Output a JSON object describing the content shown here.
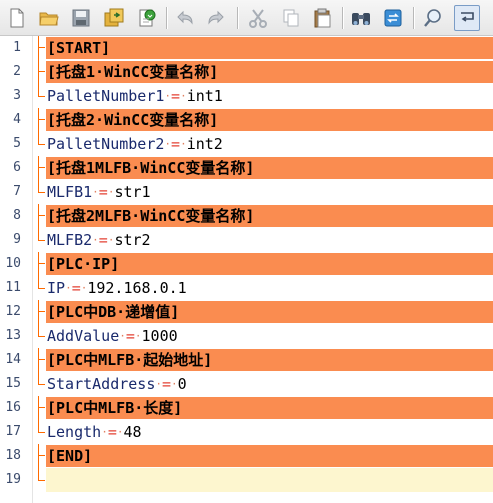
{
  "toolbar": {
    "buttons": [
      {
        "icon": "new-file-icon"
      },
      {
        "icon": "open-folder-icon"
      },
      {
        "icon": "save-icon"
      },
      {
        "icon": "save-all-icon"
      },
      {
        "icon": "reload-icon"
      },
      {
        "icon": "undo-icon"
      },
      {
        "icon": "redo-icon"
      },
      {
        "icon": "cut-icon"
      },
      {
        "icon": "copy-icon"
      },
      {
        "icon": "paste-icon"
      },
      {
        "icon": "find-icon"
      },
      {
        "icon": "replace-icon"
      },
      {
        "icon": "zoom-icon"
      },
      {
        "icon": "wrap-icon"
      }
    ]
  },
  "colors": {
    "section_highlight": "#fa8c50",
    "fold_line": "#ff6a00",
    "current_line": "#fdf6cf",
    "key_text": "#1a2a6c",
    "operator": "#e34234"
  },
  "lines": [
    {
      "n": "1",
      "type": "section",
      "text": "[START]"
    },
    {
      "n": "2",
      "type": "section",
      "text": "[托盘1·WinCC变量名称]"
    },
    {
      "n": "3",
      "type": "kv",
      "key": "PalletNumber1",
      "op": "=",
      "value": "int1"
    },
    {
      "n": "4",
      "type": "section",
      "text": "[托盘2·WinCC变量名称]"
    },
    {
      "n": "5",
      "type": "kv",
      "key": "PalletNumber2",
      "op": "=",
      "value": "int2"
    },
    {
      "n": "6",
      "type": "section",
      "text": "[托盘1MLFB·WinCC变量名称]"
    },
    {
      "n": "7",
      "type": "kv",
      "key": "MLFB1",
      "op": "=",
      "value": "str1"
    },
    {
      "n": "8",
      "type": "section",
      "text": "[托盘2MLFB·WinCC变量名称]"
    },
    {
      "n": "9",
      "type": "kv",
      "key": "MLFB2",
      "op": "=",
      "value": "str2"
    },
    {
      "n": "10",
      "type": "section",
      "text": "[PLC·IP]"
    },
    {
      "n": "11",
      "type": "kv",
      "key": "IP",
      "op": "=",
      "value": "192.168.0.1"
    },
    {
      "n": "12",
      "type": "section",
      "text": "[PLC中DB·递增值]"
    },
    {
      "n": "13",
      "type": "kv",
      "key": "AddValue",
      "op": "=",
      "value": "1000"
    },
    {
      "n": "14",
      "type": "section",
      "text": "[PLC中MLFB·起始地址]"
    },
    {
      "n": "15",
      "type": "kv",
      "key": "StartAddress",
      "op": "=",
      "value": "0"
    },
    {
      "n": "16",
      "type": "section",
      "text": "[PLC中MLFB·长度]"
    },
    {
      "n": "17",
      "type": "kv",
      "key": "Length",
      "op": "=",
      "value": "48"
    },
    {
      "n": "18",
      "type": "section",
      "text": "[END]"
    },
    {
      "n": "19",
      "type": "current",
      "text": ""
    }
  ]
}
